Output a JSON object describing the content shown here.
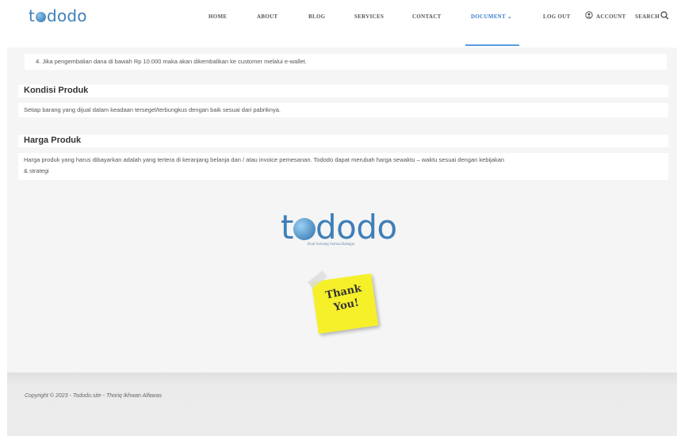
{
  "brand": {
    "name_prefix": "t",
    "name_suffix": "dodo"
  },
  "nav": {
    "items": [
      {
        "label": "HOME"
      },
      {
        "label": "ABOUT"
      },
      {
        "label": "BLOG"
      },
      {
        "label": "SERVICES"
      },
      {
        "label": "CONTACT"
      },
      {
        "label": "DOCUMENT ⌄",
        "active": true
      },
      {
        "label": "LOG OUT"
      },
      {
        "label": "ACCOUNT"
      },
      {
        "label": "SEARCH"
      }
    ]
  },
  "content": {
    "list_item_4": "4. Jika pengembalian dana di bawah Rp 10.000 maka akan dikembalikan ke customer melalui e-wallet.",
    "sections": [
      {
        "title": "Kondisi Produk",
        "body": "Setiap barang yang dijual dalam keadaan tersegel/terbungkus dengan baik sesuai dari pabriknya."
      },
      {
        "title": "Harga Produk",
        "body_line1": "Harga produk yang harus dibayarkan adalah yang tertera di keranjang belanja dan / atau invoice pemesanan. Tododo dapat merubah harga sewaktu – waktu sesuai dengan kebijakan",
        "body_line2": "& strategi"
      }
    ]
  },
  "logo": {
    "prefix": "t",
    "suffix": "dodo",
    "tagline": "Buat Semang Semua Bahagia"
  },
  "sticky_note": {
    "line1": "Thank",
    "line2": "You!"
  },
  "footer": {
    "copyright": "Copyright © 2023 - Tododo.site - Thoriq Ikhwan Alfawas"
  },
  "colors": {
    "brand": "#3f7fb8",
    "active_nav": "#3b7fd0",
    "sticky": "#f6f02a"
  }
}
